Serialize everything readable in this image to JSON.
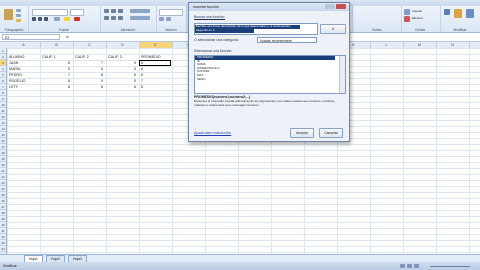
{
  "ribbon": {
    "groups": [
      "Portapapeles",
      "Fuente",
      "Alineación",
      "Número",
      "Estilos",
      "Celdas",
      "Modificar"
    ],
    "right_buttons": [
      "Insertar",
      "Eliminar",
      "Formato",
      "Ordenar y filtrar",
      "Buscar y seleccionar"
    ]
  },
  "formula_bar": {
    "name_box": "E2",
    "fx": "fx"
  },
  "columns": [
    "A",
    "B",
    "C",
    "D",
    "E",
    "F",
    "G",
    "H",
    "I",
    "J",
    "K",
    "L",
    "M",
    "N"
  ],
  "rows": [
    "1",
    "2",
    "3",
    "4",
    "5",
    "6",
    "7",
    "8",
    "9",
    "10",
    "11",
    "12",
    "13",
    "14",
    "15",
    "16",
    "17",
    "18",
    "19",
    "20",
    "21",
    "22",
    "23",
    "24",
    "25",
    "26",
    "27",
    "28",
    "29",
    "30",
    "31",
    "32",
    "33",
    "34"
  ],
  "sheet": {
    "headers": [
      "ALUMNO",
      "CALIF. 1",
      "CALIF. 2",
      "CALIF. 3",
      "PROMEDIO"
    ],
    "data": [
      [
        "JUAN",
        "8",
        "7",
        "9",
        "6"
      ],
      [
        "MARIA",
        "9",
        "6",
        "5",
        "8"
      ],
      [
        "PEDRO",
        "7",
        "8",
        "6",
        "6"
      ],
      [
        "ROGELIO",
        "8",
        "9",
        "5",
        "7"
      ],
      [
        "LETY",
        "8",
        "6",
        "6",
        "6"
      ]
    ]
  },
  "tabs": [
    "Hoja1",
    "Hoja2",
    "Hoja3"
  ],
  "status": {
    "left": "Modificar"
  },
  "dialog": {
    "title": "Insertar función",
    "search_label": "Buscar una función:",
    "search_value_1": "Escriba una breve descripción de lo que desea hacer y, a continuación,",
    "search_value_2": "haga clic en Ir",
    "go_button": "Ir",
    "category_label": "O seleccionar una categoría:",
    "category_value": "Usadas recientemente",
    "select_label": "Seleccionar una función:",
    "functions": [
      "PROMEDIO",
      "SI",
      "SUMA",
      "HIPERVINCULO",
      "CONTAR",
      "MAX",
      "SENO"
    ],
    "syntax": "PROMEDIO(número1;número2;...)",
    "description": "Devuelve el promedio (media aritmética) de los argumentos, los cuales pueden ser números, nombres, matrices o referencias que contengan números.",
    "help_link": "Ayuda sobre esta función",
    "ok": "Aceptar",
    "cancel": "Cancelar"
  }
}
